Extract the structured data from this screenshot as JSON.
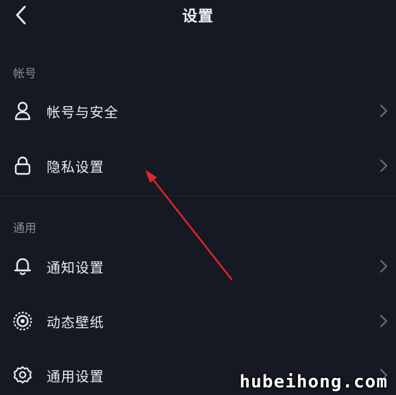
{
  "header": {
    "title": "设置",
    "back_icon": "chevron-left-icon"
  },
  "sections": [
    {
      "header": "帐号",
      "items": [
        {
          "label": "帐号与安全",
          "icon": "user-icon"
        },
        {
          "label": "隐私设置",
          "icon": "lock-icon"
        }
      ]
    },
    {
      "header": "通用",
      "items": [
        {
          "label": "通知设置",
          "icon": "bell-icon"
        },
        {
          "label": "动态壁纸",
          "icon": "live-wallpaper-icon"
        },
        {
          "label": "通用设置",
          "icon": "gear-icon"
        }
      ]
    }
  ],
  "watermark": "hubeihong.com",
  "colors": {
    "background": "#161823",
    "text": "#ececee",
    "section_header": "#8a8b93",
    "chevron": "#6d6e76",
    "annotation_arrow": "#e0262a"
  }
}
